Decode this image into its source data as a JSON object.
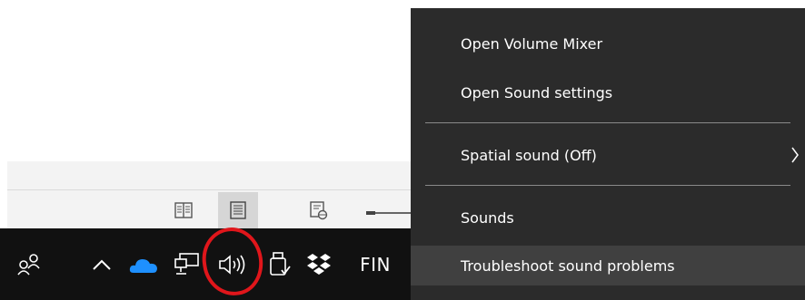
{
  "context_menu": {
    "items": [
      {
        "label": "Open Volume Mixer"
      },
      {
        "label": "Open Sound settings"
      },
      {
        "label": "Spatial sound (Off)"
      },
      {
        "label": "Sounds"
      },
      {
        "label": "Troubleshoot sound problems"
      }
    ],
    "hovered_item": "Troubleshoot sound problems",
    "background_color": "#2b2b2b",
    "hover_color": "#404040"
  },
  "taskbar": {
    "language_indicator": "FIN",
    "icons": [
      "people-icon",
      "show-hidden-icons-chevron",
      "onedrive-cloud-icon",
      "network-icon",
      "volume-speaker-icon",
      "usb-safely-remove-icon",
      "dropbox-icon"
    ],
    "background_color": "#111111"
  },
  "status_bar": {
    "icons": [
      "read-mode-icon",
      "print-layout-icon",
      "web-layout-icon"
    ],
    "active_view": "print-layout-icon"
  },
  "annotation": {
    "type": "red-circle",
    "target": "volume-speaker-icon",
    "color": "#e0161b"
  }
}
